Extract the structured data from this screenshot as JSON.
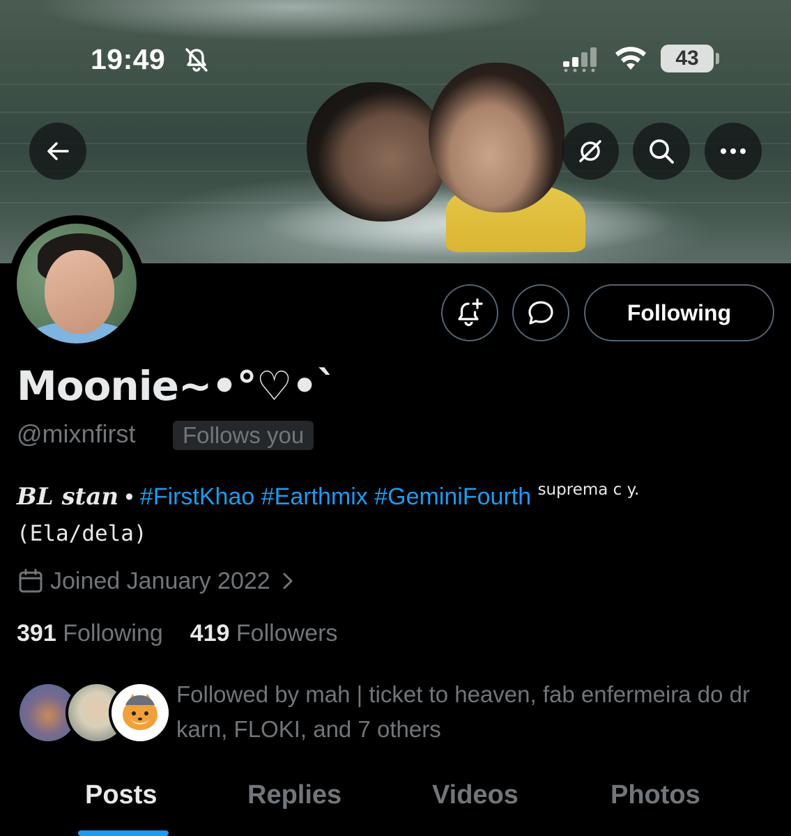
{
  "status_bar": {
    "time": "19:49",
    "battery": "43"
  },
  "profile": {
    "display_name": "Moonie~•°♡•`",
    "handle": "@mixnfirst",
    "follows_you": "Follows you",
    "following_button": "Following",
    "bio": {
      "bl_stan": "BL stan",
      "separator": " • ",
      "hashtags": [
        "#FirstKhao",
        "#Earthmix",
        "#GeminiFourth"
      ],
      "suffix": "suprema c y.",
      "pronouns": "(Ela/dela)"
    },
    "joined": "Joined January 2022",
    "following_count": "391",
    "following_label": "Following",
    "followers_count": "419",
    "followers_label": "Followers",
    "followers_you_know": "Followed by mah | ticket to heaven, fab enfermeira do dr karn, FLOKI, and 7 others"
  },
  "tabs": [
    "Posts",
    "Replies",
    "Videos",
    "Photos"
  ],
  "active_tab": "Posts",
  "icons": {
    "back": "arrow-left-icon",
    "grok": "grok-icon",
    "search": "search-icon",
    "more": "more-icon",
    "notifications": "bell-plus-icon",
    "message": "message-bubble-icon",
    "calendar": "calendar-icon",
    "chevron": "chevron-right-icon",
    "mute": "bell-off-icon",
    "signal": "signal-icon",
    "wifi": "wifi-icon"
  },
  "colors": {
    "background": "#000000",
    "primary_text": "#e7e9ea",
    "secondary_text": "#71767b",
    "accent": "#1d9bf0",
    "border": "#536471"
  }
}
